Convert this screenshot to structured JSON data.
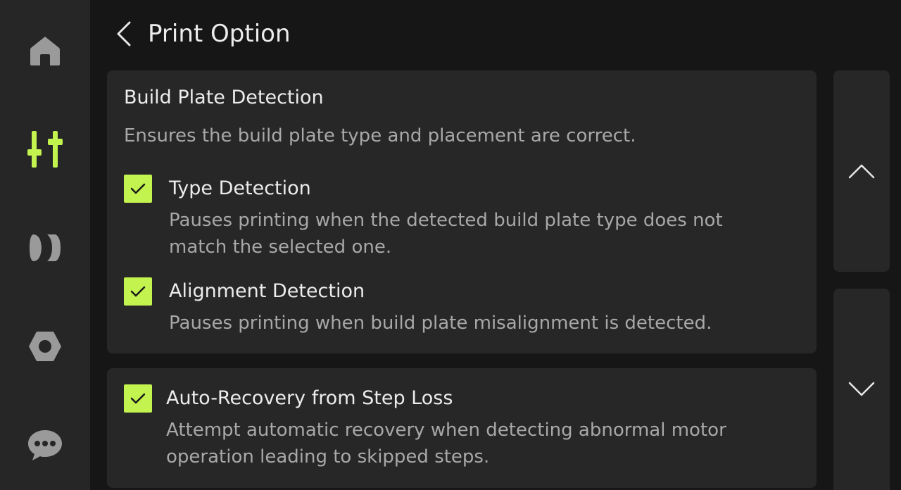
{
  "header": {
    "title": "Print Option"
  },
  "sidebar": {
    "items": [
      {
        "icon": "home-icon",
        "active": false
      },
      {
        "icon": "controls-icon",
        "active": true
      },
      {
        "icon": "filament-icon",
        "active": false
      },
      {
        "icon": "settings-nut-icon",
        "active": false
      },
      {
        "icon": "chat-icon",
        "active": false
      }
    ]
  },
  "build_plate": {
    "title": "Build Plate Detection",
    "description": "Ensures the build plate type and placement are correct.",
    "options": [
      {
        "label": "Type Detection",
        "description_line1": "Pauses printing when the detected build plate type does not",
        "description_line2": "match the selected one.",
        "checked": true
      },
      {
        "label": "Alignment Detection",
        "description_line1": "Pauses printing when build plate misalignment is detected.",
        "checked": true
      }
    ]
  },
  "step_loss": {
    "label": "Auto-Recovery from Step Loss",
    "description_line1": "Attempt automatic recovery when detecting abnormal motor",
    "description_line2": "operation leading to skipped steps.",
    "checked": true
  },
  "colors": {
    "accent": "#c3f34e",
    "background": "#161616",
    "sidebar": "#262626",
    "card": "#272727",
    "icon_inactive": "#9a9a9a"
  }
}
